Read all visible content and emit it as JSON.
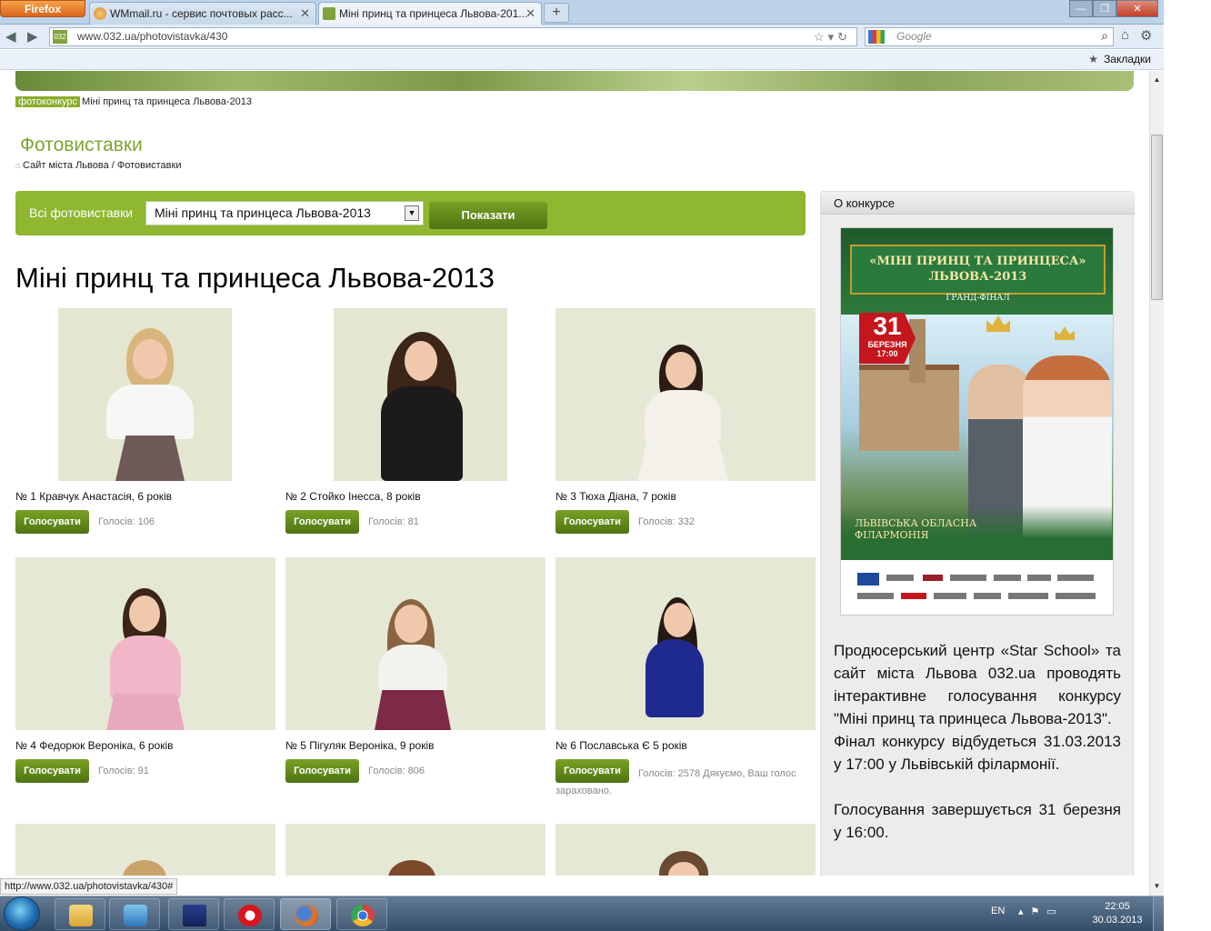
{
  "browser": {
    "app_button": "Firefox",
    "tabs": [
      {
        "title": "WMmail.ru - сервис почтовых расс...",
        "active": false
      },
      {
        "title": "Міні принц та принцеса Львова-201...",
        "active": true
      }
    ],
    "favicon_site": "032",
    "url": "www.032.ua/photovistavka/430",
    "search_placeholder": "Google",
    "bookmarks_label": "Закладки",
    "status_url": "http://www.032.ua/photovistavka/430#"
  },
  "page": {
    "top_breadcrumb": {
      "tag": "фотоконкурс",
      "text": "Міні принц та принцеса Львова-2013"
    },
    "section_title": "Фотовиставки",
    "crumbs": {
      "home": "Сайт міста Львова",
      "separator": " / ",
      "current": "Фотовиставки"
    },
    "filter": {
      "label": "Всі фотовиставки",
      "selected": "Міні принц та принцеса Львова-2013",
      "button": "Показати"
    },
    "gallery_title": "Міні принц та принцеса Львова-2013",
    "vote_button_label": "Голосувати",
    "entries": [
      {
        "caption": "№ 1 Кравчук Анастасія, 6 років",
        "votes": "Голосів: 106"
      },
      {
        "caption": "№ 2 Стойко Інесса, 8 років",
        "votes": "Голосів: 81"
      },
      {
        "caption": "№ 3 Тюха Діана, 7 років",
        "votes": "Голосів: 332"
      },
      {
        "caption": "№ 4 Федорюк Вероніка, 6 років",
        "votes": "Голосів: 91"
      },
      {
        "caption": "№ 5 Пігуляк Вероніка, 9 років",
        "votes": "Голосів: 806"
      },
      {
        "caption": "№ 6 Пославська Є 5 років",
        "votes": "Голосів: 2578 Дякуємо, Ваш голос зараховано."
      }
    ]
  },
  "sidebar": {
    "title": "О конкурсе",
    "poster": {
      "title": "«МІНІ ПРИНЦ ТА ПРИНЦЕСА» ЛЬВОВА-2013",
      "subtitle": "ГРАНД-ФІНАЛ",
      "day": "31",
      "month": "БЕРЕЗНЯ",
      "time": "17:00",
      "venue": "ЛЬВІВСЬКА ОБЛАСНА ФІЛАРМОНІЯ"
    },
    "paragraphs": [
      "Продюсерський центр «Star School» та сайт міста Львова 032.ua проводять інтерактивне голосування конкурсу \"Міні принц та принцеса Львова-2013\".",
      "Фінал конкурсу відбудеться 31.03.2013 у 17:00 у Львівській філармонії.",
      "Голосування завершується 31 березня у 16:00."
    ]
  },
  "taskbar": {
    "language": "EN",
    "time": "22:05",
    "date": "30.03.2013"
  },
  "colors": {
    "accent_green": "#8fb72f",
    "title_green": "#7ea531",
    "button_green": "#5c8219"
  }
}
